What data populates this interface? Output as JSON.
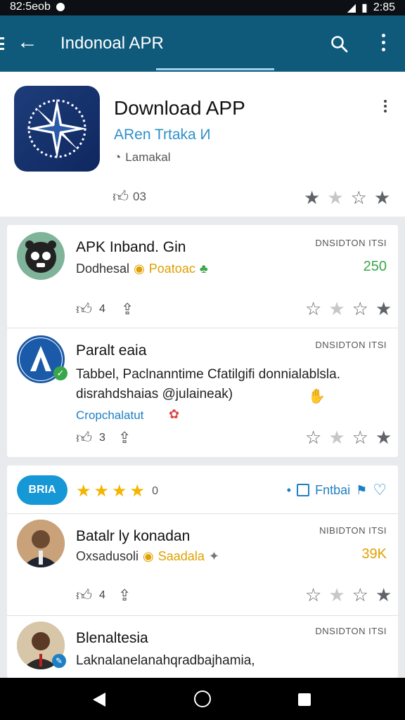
{
  "status": {
    "left_text": "82:5eob",
    "right_text": "2:85"
  },
  "appbar": {
    "title": "Indonoal APR"
  },
  "hero": {
    "title": "Download APP",
    "subtitle": "ARen Trtaka И",
    "meta": "Lamakal",
    "likes": "03"
  },
  "cards": [
    {
      "name": "APK Inband. Gin",
      "line2_text": "Dodhesal",
      "line2_badge": "Poatoac",
      "tag": "DNSIDTON ITSI",
      "count": "250",
      "likes": "4"
    },
    {
      "name": "Paralt eaia",
      "tag": "DNSIDTON ITSI",
      "desc": "Tabbel, Paclnanntime Cfatilgifi donnialablsla. disrahdshaias @julaineak)",
      "link": "Cropchalatut",
      "likes": "3"
    }
  ],
  "card2": {
    "pill": "BRIA",
    "rating": "0",
    "action_label": "Fntbai",
    "rows": [
      {
        "name": "Batalr ly konadan",
        "line2_text": "Oxsadusoli",
        "line2_badge": "Saadala",
        "tag": "NIBIDTON ITSI",
        "count": "39K",
        "likes": "4"
      },
      {
        "name": "Blenaltesia",
        "tag": "DNSIDTON ITSI",
        "desc": "Laknalanelanahqradbajhamia,"
      }
    ]
  },
  "colors": {
    "appbar": "#0f5a7b",
    "accent": "#1697d6",
    "green": "#3aa64a"
  }
}
